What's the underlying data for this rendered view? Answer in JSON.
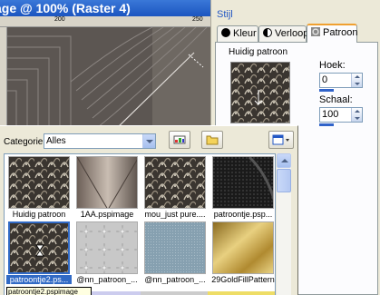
{
  "canvas": {
    "title": "age  @ 100% (Raster 4)",
    "ruler_labels": [
      "200",
      "250"
    ]
  },
  "style_panel": {
    "header": "Stijl",
    "tabs": [
      {
        "label": "Kleur",
        "icon": "filled-circle-icon"
      },
      {
        "label": "Verloop",
        "icon": "gradient-circle-icon"
      },
      {
        "label": "Patroon",
        "icon": "pattern-icon",
        "active": true
      }
    ],
    "current_pattern_label": "Huidig patroon",
    "angle_label": "Hoek:",
    "angle_value": "0",
    "scale_label": "Schaal:",
    "scale_value": "100"
  },
  "browser": {
    "category_label": "Categorie:",
    "category_value": "Alles",
    "items": [
      {
        "label": "Huidig patroon",
        "kind": "feather"
      },
      {
        "label": "1AA.pspimage",
        "kind": "metal"
      },
      {
        "label": "mou_just pure....",
        "kind": "feather"
      },
      {
        "label": "patroontje.psp...",
        "kind": "carbon"
      },
      {
        "label": "patroontje2.ps...",
        "kind": "feather",
        "selected": true
      },
      {
        "label": "@nn_patroon_...",
        "kind": "lace"
      },
      {
        "label": "@nn_patroon_...",
        "kind": "denim"
      },
      {
        "label": "29GoldFillPattern",
        "kind": "gold"
      }
    ],
    "tooltip": "patroontje2.pspimage"
  },
  "colors": {
    "selection": "#316ac5",
    "tab_accent": "#f0a030",
    "link_blue": "#2458c4"
  }
}
